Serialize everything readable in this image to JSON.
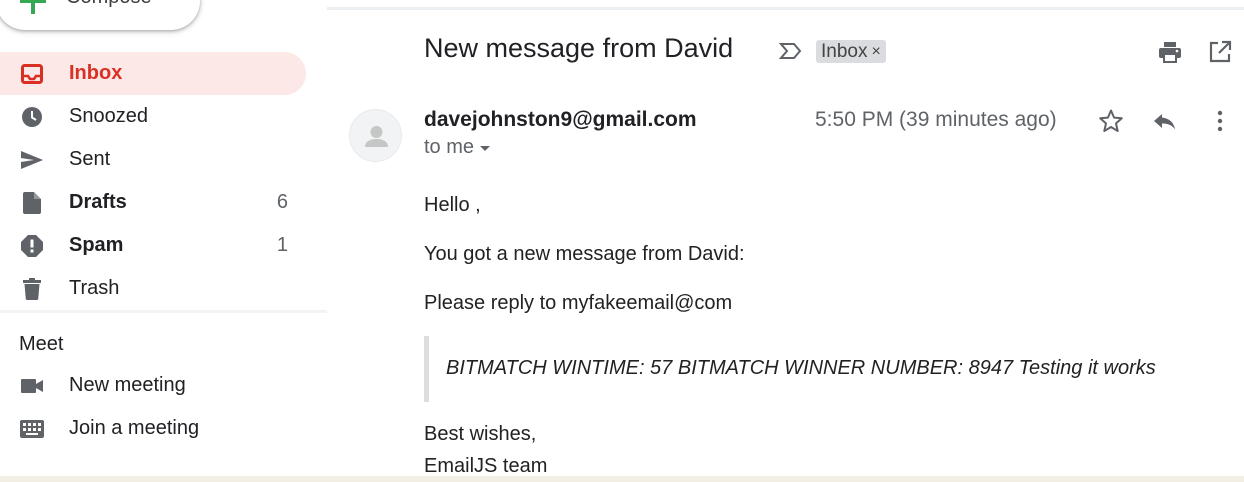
{
  "compose": {
    "label": "Compose"
  },
  "sidebar": {
    "items": [
      {
        "label": "Inbox",
        "count": "",
        "active": true,
        "bold": true,
        "icon": "inbox-icon"
      },
      {
        "label": "Snoozed",
        "count": "",
        "icon": "clock-icon"
      },
      {
        "label": "Sent",
        "count": "",
        "icon": "send-icon"
      },
      {
        "label": "Drafts",
        "count": "6",
        "bold": true,
        "icon": "draft-icon"
      },
      {
        "label": "Spam",
        "count": "1",
        "bold": true,
        "icon": "spam-icon"
      },
      {
        "label": "Trash",
        "count": "",
        "icon": "trash-icon"
      }
    ],
    "meet": {
      "title": "Meet",
      "items": [
        {
          "label": "New meeting",
          "icon": "video-icon"
        },
        {
          "label": "Join a meeting",
          "icon": "keyboard-icon"
        }
      ]
    }
  },
  "message": {
    "subject": "New message from David",
    "label": "Inbox",
    "label_close": "×",
    "sender": "davejohnston9@gmail.com",
    "to": "to me",
    "time": "5:50 PM (39 minutes ago)",
    "greeting": "Hello ,",
    "line1": "You got a new message from David:",
    "line2": "Please reply to myfakeemail@com",
    "quote": "BITMATCH WINTIME: 57 BITMATCH WINNER NUMBER: 8947 Testing it works",
    "signoff": "Best wishes,",
    "signature": "EmailJS team"
  },
  "colors": {
    "accent": "#d93025",
    "active_bg": "#fce8e6",
    "compose_plus": "#34a853",
    "icon_gray": "#5f6368"
  }
}
